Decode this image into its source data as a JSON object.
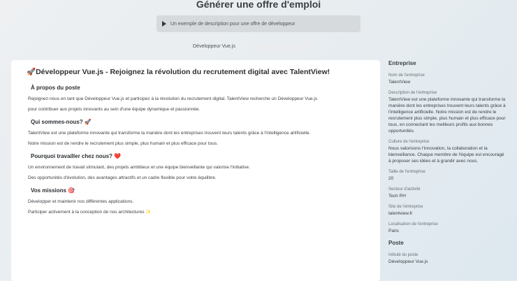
{
  "header": {
    "title": "Générer une offre d'emploi",
    "prompt_text": "Un exemple de description pour une offre de développeur",
    "tabs": [
      {
        "label": "Développeur Vue.js",
        "active": true
      },
      {
        "label": "",
        "active": false
      }
    ]
  },
  "main": {
    "title": "🚀Développeur Vue.js - Rejoignez la révolution du recrutement digital avec TalentView!",
    "sections": [
      {
        "heading": "À propos du poste",
        "paragraphs": [
          "Rejoignez-nous en tant que Développeur Vue.js et participez à la révolution du recrutement digital. TalentView recherche un Développeur Vue.js",
          "pour contribuer aux projets innovants au sein d'une équipe dynamique et passionnée."
        ]
      },
      {
        "heading": "Qui sommes-nous? 🚀",
        "paragraphs": [
          "TalentView est une plateforme innovante qui transforme la manière dont les entreprises trouvent leurs talents grâce à l'intelligence artificielle.",
          "Notre mission est de rendre le recrutement plus simple, plus humain et plus efficace pour tous."
        ]
      },
      {
        "heading": "Pourquoi travailler chez nous? ❤️",
        "paragraphs": [
          "Un environnement de travail stimulant, des projets ambitieux et une équipe bienveillante qui valorise l'initiative.",
          "Des opportunités d'évolution, des avantages attractifs et un cadre flexible pour votre équilibre."
        ]
      },
      {
        "heading": "Vos missions 🎯",
        "paragraphs": [
          "Développer et maintenir nos différentes applications.",
          "Participer activement à la conception de nos architectures ✨"
        ]
      }
    ]
  },
  "sidebar": {
    "heading": "Entreprise",
    "blocks": [
      {
        "label": "Nom de l'entreprise",
        "value": "TalentView"
      },
      {
        "label": "Description de l'entreprise",
        "value": "TalentView est une plateforme innovante qui transforme la manière dont les entreprises trouvent leurs talents grâce à l'intelligence artificielle. Notre mission est de rendre le recrutement plus simple, plus humain et plus efficace pour tous, en connectant les meilleurs profils aux bonnes opportunités."
      },
      {
        "label": "Culture de l'entreprise",
        "value": "Nous valorisons l'innovation, la collaboration et la bienveillance. Chaque membre de l'équipe est encouragé à proposer ses idées et à grandir avec nous."
      },
      {
        "label": "Taille de l'entreprise",
        "value": "20"
      },
      {
        "label": "Secteur d'activité",
        "value": "Tech RH"
      },
      {
        "label": "Site de l'entreprise",
        "value": "talentview.fr"
      },
      {
        "label": "Localisation de l'entreprise",
        "value": "Paris"
      }
    ],
    "heading2": "Poste",
    "blocks2": [
      {
        "label": "Intitulé du poste",
        "value": "Développeur Vue.js"
      }
    ]
  }
}
